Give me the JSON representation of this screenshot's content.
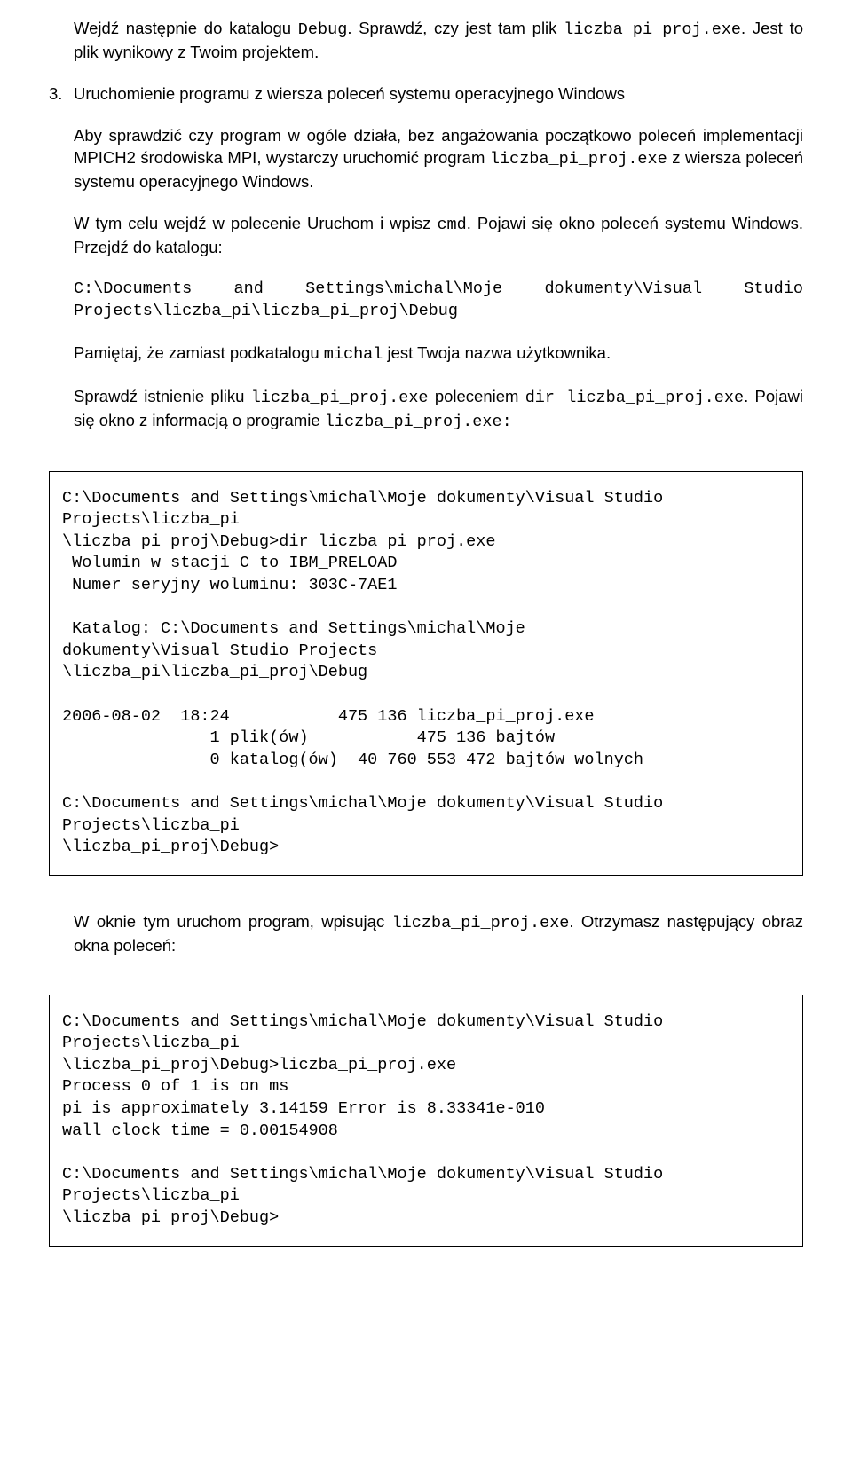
{
  "p1_a": "Wejdź następnie do katalogu ",
  "p1_b": "Debug",
  "p1_c": ". Sprawdź, czy jest tam plik ",
  "p1_d": "liczba_pi_proj.exe",
  "p1_e": ". Jest to plik wynikowy z Twoim projektem.",
  "num3": "3.",
  "p2": "Uruchomienie programu z wiersza poleceń systemu operacyjnego Windows",
  "p3_a": "Aby sprawdzić czy program w ogóle działa, bez angażowania początkowo poleceń implementacji MPICH2 środowiska MPI, wystarczy uruchomić program ",
  "p3_b": "liczba_pi_proj.exe",
  "p3_c": " z wiersza poleceń systemu operacyjnego Windows.",
  "p4_a": "W tym celu wejdź w polecenie Uruchom i wpisz ",
  "p4_b": "cmd",
  "p4_c": ". Pojawi się okno poleceń systemu Windows. Przejdź do katalogu:",
  "p5": "C:\\Documents and Settings\\michal\\Moje dokumenty\\Visual Studio Projects\\liczba_pi\\liczba_pi_proj\\Debug",
  "p6_a": "Pamiętaj, że zamiast podkatalogu ",
  "p6_b": "michal",
  "p6_c": "  jest Twoja nazwa użytkownika.",
  "p7_a": "Sprawdź istnienie pliku ",
  "p7_b": "liczba_pi_proj.exe",
  "p7_c": " poleceniem ",
  "p7_d": "dir liczba_pi_proj.exe",
  "p7_e": ". Pojawi się okno z informacją o programie ",
  "p7_f": "liczba_pi_proj.exe:",
  "code1": "C:\\Documents and Settings\\michal\\Moje dokumenty\\Visual Studio\nProjects\\liczba_pi\n\\liczba_pi_proj\\Debug>dir liczba_pi_proj.exe\n Wolumin w stacji C to IBM_PRELOAD\n Numer seryjny woluminu: 303C-7AE1\n\n Katalog: C:\\Documents and Settings\\michal\\Moje\ndokumenty\\Visual Studio Projects\n\\liczba_pi\\liczba_pi_proj\\Debug\n\n2006-08-02  18:24           475 136 liczba_pi_proj.exe\n               1 plik(ów)           475 136 bajtów\n               0 katalog(ów)  40 760 553 472 bajtów wolnych\n\nC:\\Documents and Settings\\michal\\Moje dokumenty\\Visual Studio\nProjects\\liczba_pi\n\\liczba_pi_proj\\Debug>",
  "p8_a": "W oknie tym uruchom program, wpisując ",
  "p8_b": "liczba_pi_proj.exe",
  "p8_c": ". Otrzymasz następujący obraz okna poleceń:",
  "code2": "C:\\Documents and Settings\\michal\\Moje dokumenty\\Visual Studio\nProjects\\liczba_pi\n\\liczba_pi_proj\\Debug>liczba_pi_proj.exe\nProcess 0 of 1 is on ms\npi is approximately 3.14159 Error is 8.33341e-010\nwall clock time = 0.00154908\n\nC:\\Documents and Settings\\michal\\Moje dokumenty\\Visual Studio\nProjects\\liczba_pi\n\\liczba_pi_proj\\Debug>"
}
